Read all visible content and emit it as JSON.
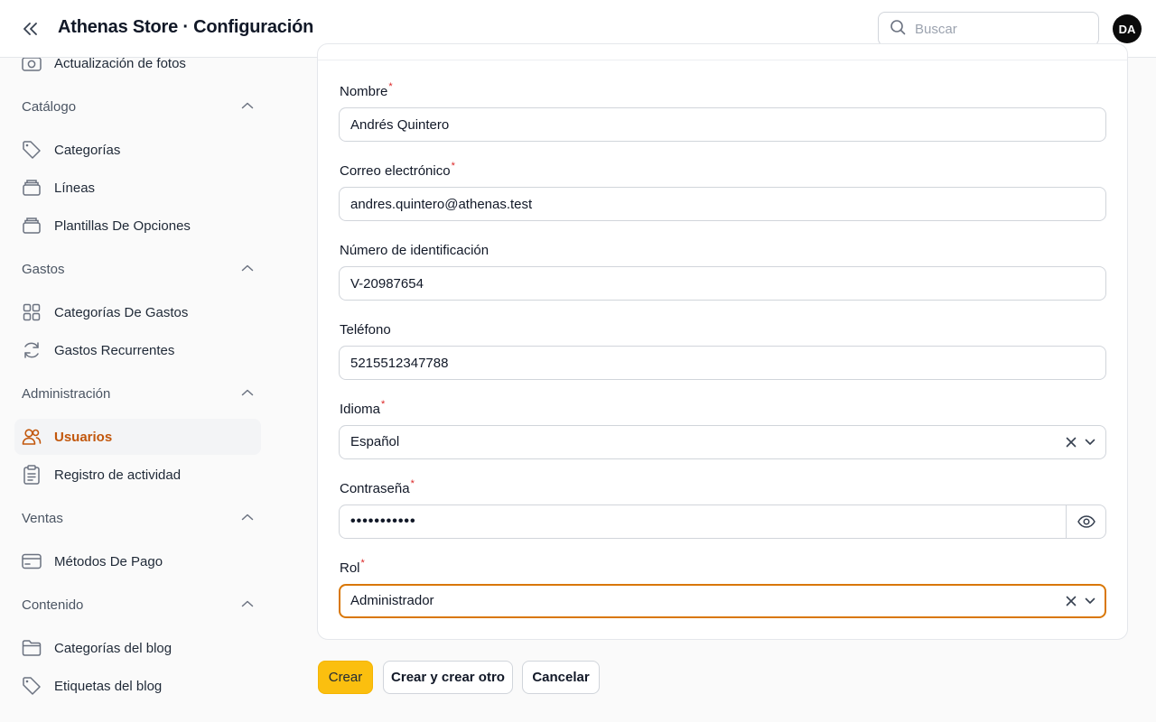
{
  "header": {
    "title": "Athenas Store · Configuración",
    "search_placeholder": "Buscar",
    "avatar_initials": "DA"
  },
  "sidebar": {
    "top_item": {
      "label": "Actualización de fotos",
      "icon": "camera-icon"
    },
    "groups": [
      {
        "label": "Catálogo",
        "items": [
          {
            "label": "Categorías",
            "icon": "tag-icon"
          },
          {
            "label": "Líneas",
            "icon": "stack-icon"
          },
          {
            "label": "Plantillas De Opciones",
            "icon": "stack-icon"
          }
        ]
      },
      {
        "label": "Gastos",
        "items": [
          {
            "label": "Categorías De Gastos",
            "icon": "grid-icon"
          },
          {
            "label": "Gastos Recurrentes",
            "icon": "refresh-icon"
          }
        ]
      },
      {
        "label": "Administración",
        "items": [
          {
            "label": "Usuarios",
            "icon": "users-icon",
            "active": true
          },
          {
            "label": "Registro de actividad",
            "icon": "clipboard-icon"
          }
        ]
      },
      {
        "label": "Ventas",
        "items": [
          {
            "label": "Métodos De Pago",
            "icon": "credit-card-icon"
          }
        ]
      },
      {
        "label": "Contenido",
        "items": [
          {
            "label": "Categorías del blog",
            "icon": "folder-icon"
          },
          {
            "label": "Etiquetas del blog",
            "icon": "tag-icon"
          }
        ]
      }
    ]
  },
  "form": {
    "name": {
      "label": "Nombre",
      "required": "*",
      "value": "Andrés Quintero"
    },
    "email": {
      "label": "Correo electrónico",
      "required": "*",
      "value": "andres.quintero@athenas.test"
    },
    "id_number": {
      "label": "Número de identificación",
      "value": "V-20987654"
    },
    "phone": {
      "label": "Teléfono",
      "value": "5215512347788"
    },
    "language": {
      "label": "Idioma",
      "required": "*",
      "value": "Español"
    },
    "password": {
      "label": "Contraseña",
      "required": "*",
      "masked": "•••••••••••"
    },
    "role": {
      "label": "Rol",
      "required": "*",
      "value": "Administrador"
    }
  },
  "actions": {
    "create": "Crear",
    "create_another": "Crear y crear otro",
    "cancel": "Cancelar"
  },
  "colors": {
    "accent": "#fbbf0f",
    "active_nav": "#c2570c",
    "focus_border": "#d97706",
    "required": "#dc2626"
  }
}
